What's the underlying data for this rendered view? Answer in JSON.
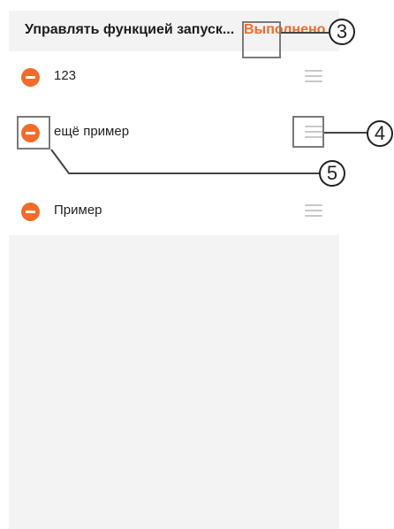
{
  "header": {
    "title": "Управлять функцией запуск...",
    "done_label": "Выполнено"
  },
  "apps": [
    {
      "label": "123"
    },
    {
      "label": "ещё пример"
    },
    {
      "label": "Пример"
    }
  ],
  "callouts": [
    "3",
    "4",
    "5"
  ],
  "colors": {
    "accent": "#f26b2a",
    "panel": "#f3f3f3",
    "text": "#1d1d1d"
  },
  "icons": {
    "remove": "minus-circle-icon",
    "drag": "drag-handle-icon"
  }
}
